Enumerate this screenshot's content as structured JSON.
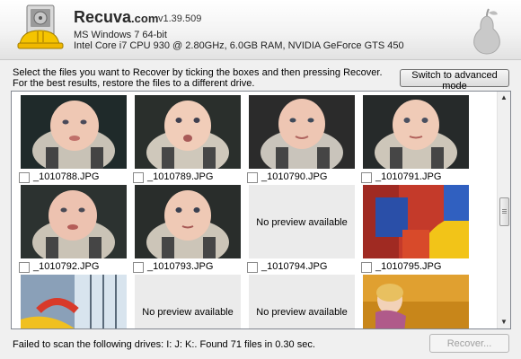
{
  "header": {
    "app_name": "Recuva",
    "app_suffix": ".com",
    "version": "v1.39.509",
    "os": "MS Windows 7 64-bit",
    "hardware": "Intel Core i7 CPU 930 @ 2.80GHz, 6.0GB RAM, NVIDIA GeForce GTS 450"
  },
  "instructions": {
    "line1": "Select the files you want to Recover by ticking the boxes and then pressing Recover.",
    "line2": "For the best results, restore the files to a different drive."
  },
  "advanced_button": "Switch to advanced mode",
  "no_preview_text": "No preview available",
  "files": [
    {
      "name": "_1010788.JPG",
      "preview": "baby-photo"
    },
    {
      "name": "_1010789.JPG",
      "preview": "baby-photo"
    },
    {
      "name": "_1010790.JPG",
      "preview": "baby-photo"
    },
    {
      "name": "_1010791.JPG",
      "preview": "baby-photo"
    },
    {
      "name": "_1010792.JPG",
      "preview": "baby-photo"
    },
    {
      "name": "_1010793.JPG",
      "preview": "baby-photo"
    },
    {
      "name": "_1010794.JPG",
      "preview": "none"
    },
    {
      "name": "_1010795.JPG",
      "preview": "bouncy-castle-photo"
    },
    {
      "name": "",
      "preview": "slide-photo"
    },
    {
      "name": "",
      "preview": "none"
    },
    {
      "name": "",
      "preview": "none"
    },
    {
      "name": "",
      "preview": "child-photo"
    }
  ],
  "status": "Failed to scan the following drives: I: J: K:.  Found 71 files in 0.30 sec.",
  "recover_button": "Recover...",
  "colors": {
    "window_bg": "#f0f0f0",
    "panel_bg": "#ffffff",
    "no_preview_bg": "#ebebeb"
  }
}
